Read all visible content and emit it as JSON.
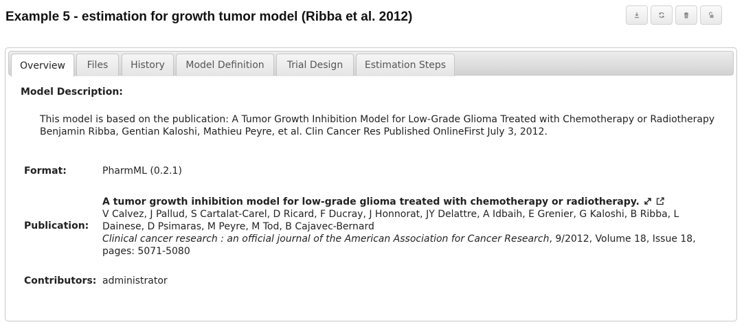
{
  "page": {
    "title": "Example 5 - estimation for growth tumor model (Ribba et al. 2012)"
  },
  "actions": [
    {
      "icon": "download-icon"
    },
    {
      "icon": "sync-icon"
    },
    {
      "icon": "trash-icon"
    },
    {
      "icon": "unlock-icon"
    }
  ],
  "tabs": [
    {
      "label": "Overview",
      "active": true
    },
    {
      "label": "Files",
      "active": false
    },
    {
      "label": "History",
      "active": false
    },
    {
      "label": "Model Definition",
      "active": false
    },
    {
      "label": "Trial Design",
      "active": false
    },
    {
      "label": "Estimation Steps",
      "active": false
    }
  ],
  "overview": {
    "model_description_label": "Model Description:",
    "description_line1": "This model is based on the publication: A Tumor Growth Inhibition Model for Low-Grade Glioma Treated with Chemotherapy or Radiotherapy",
    "description_line2": "Benjamin Ribba, Gentian Kaloshi, Mathieu Peyre, et al. Clin Cancer Res Published OnlineFirst July 3, 2012.",
    "format_label": "Format:",
    "format_value": "PharmML (0.2.1)",
    "publication_label": "Publication:",
    "publication": {
      "title": "A tumor growth inhibition model for low-grade glioma treated with chemotherapy or radiotherapy.",
      "authors": "V Calvez, J Pallud, S Cartalat-Carel, D Ricard, F Ducray, J Honnorat, JY Delattre, A Idbaih, E Grenier, G Kaloshi, B Ribba, L Dainese, D Psimaras, M Peyre, M Tod, B Cajavec-Bernard",
      "journal": "Clinical cancer research : an official journal of the American Association for Cancer Research",
      "details": ", 9/2012, Volume 18, Issue 18, pages: 5071-5080"
    },
    "contributors_label": "Contributors:",
    "contributors_value": "administrator"
  }
}
